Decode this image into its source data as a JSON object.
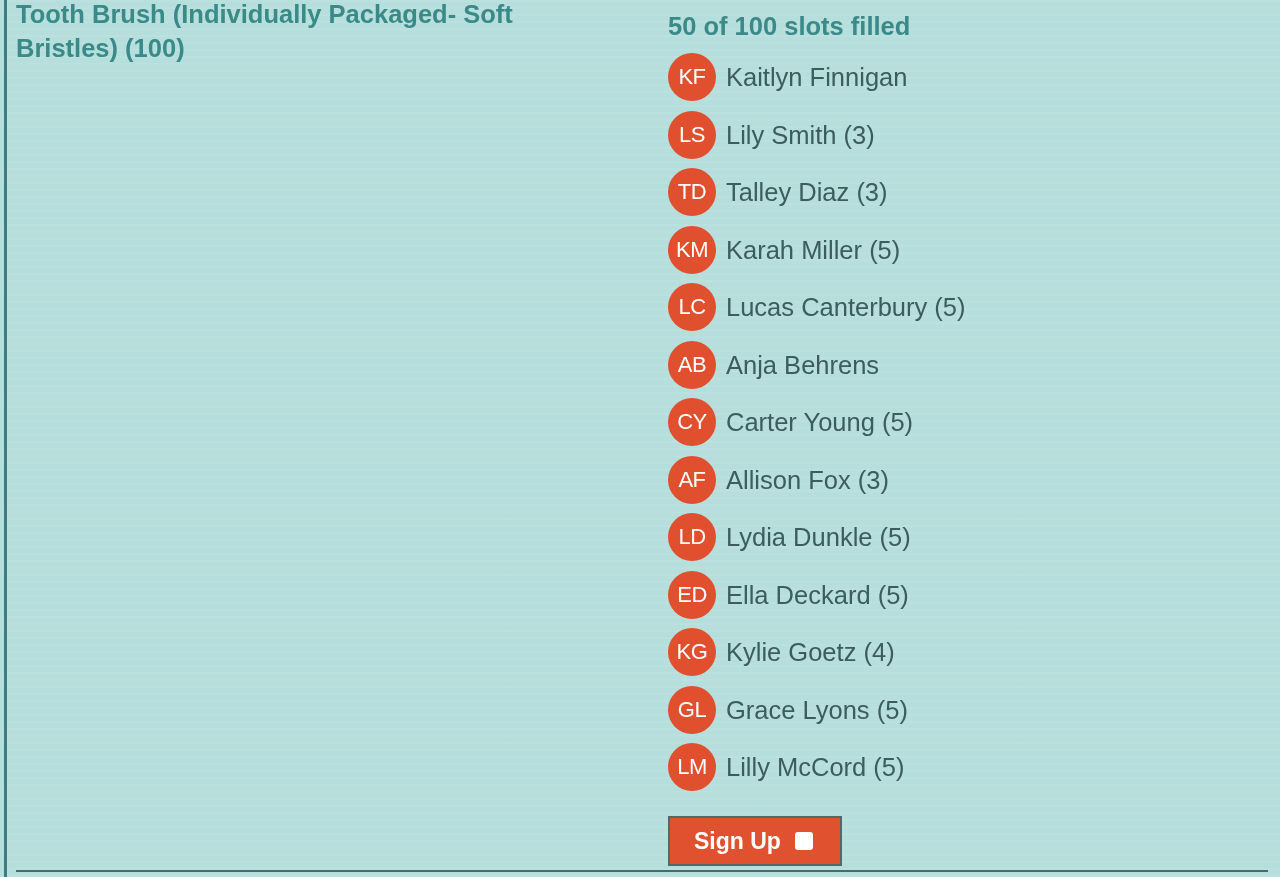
{
  "item": {
    "title": "Tooth Brush (Individually Packaged- Soft Bristles) (100)"
  },
  "slots": {
    "summary": "50 of 100 slots filled",
    "signups": [
      {
        "initials": "KF",
        "name": "Kaitlyn Finnigan"
      },
      {
        "initials": "LS",
        "name": "Lily Smith (3)"
      },
      {
        "initials": "TD",
        "name": "Talley Diaz (3)"
      },
      {
        "initials": "KM",
        "name": "Karah Miller (5)"
      },
      {
        "initials": "LC",
        "name": "Lucas Canterbury (5)"
      },
      {
        "initials": "AB",
        "name": "Anja Behrens"
      },
      {
        "initials": "CY",
        "name": "Carter Young (5)"
      },
      {
        "initials": "AF",
        "name": "Allison Fox (3)"
      },
      {
        "initials": "LD",
        "name": "Lydia Dunkle (5)"
      },
      {
        "initials": "ED",
        "name": "Ella Deckard (5)"
      },
      {
        "initials": "KG",
        "name": "Kylie Goetz (4)"
      },
      {
        "initials": "GL",
        "name": "Grace Lyons (5)"
      },
      {
        "initials": "LM",
        "name": "Lilly McCord (5)"
      }
    ]
  },
  "signup_button": {
    "label": "Sign Up",
    "checked": false
  }
}
